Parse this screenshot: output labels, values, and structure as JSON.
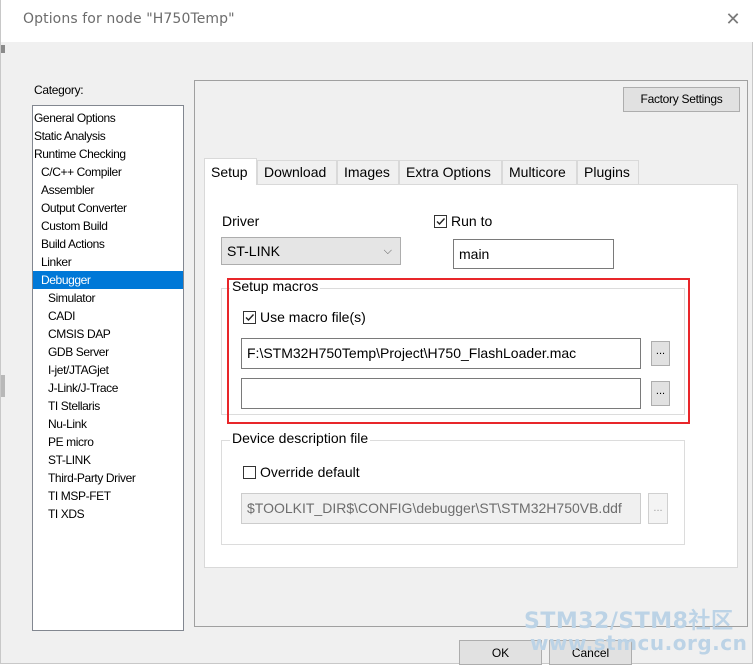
{
  "window": {
    "title": "Options for node \"H750Temp\""
  },
  "category": {
    "label": "Category:",
    "items": [
      {
        "label": "General Options",
        "level": 0,
        "selected": false
      },
      {
        "label": "Static Analysis",
        "level": 0,
        "selected": false
      },
      {
        "label": "Runtime Checking",
        "level": 0,
        "selected": false
      },
      {
        "label": "C/C++ Compiler",
        "level": 1,
        "selected": false
      },
      {
        "label": "Assembler",
        "level": 1,
        "selected": false
      },
      {
        "label": "Output Converter",
        "level": 1,
        "selected": false
      },
      {
        "label": "Custom Build",
        "level": 1,
        "selected": false
      },
      {
        "label": "Build Actions",
        "level": 1,
        "selected": false
      },
      {
        "label": "Linker",
        "level": 1,
        "selected": false
      },
      {
        "label": "Debugger",
        "level": 1,
        "selected": true
      },
      {
        "label": "Simulator",
        "level": 2,
        "selected": false
      },
      {
        "label": "CADI",
        "level": 2,
        "selected": false
      },
      {
        "label": "CMSIS DAP",
        "level": 2,
        "selected": false
      },
      {
        "label": "GDB Server",
        "level": 2,
        "selected": false
      },
      {
        "label": "I-jet/JTAGjet",
        "level": 2,
        "selected": false
      },
      {
        "label": "J-Link/J-Trace",
        "level": 2,
        "selected": false
      },
      {
        "label": "TI Stellaris",
        "level": 2,
        "selected": false
      },
      {
        "label": "Nu-Link",
        "level": 2,
        "selected": false
      },
      {
        "label": "PE micro",
        "level": 2,
        "selected": false
      },
      {
        "label": "ST-LINK",
        "level": 2,
        "selected": false
      },
      {
        "label": "Third-Party Driver",
        "level": 2,
        "selected": false
      },
      {
        "label": "TI MSP-FET",
        "level": 2,
        "selected": false
      },
      {
        "label": "TI XDS",
        "level": 2,
        "selected": false
      }
    ]
  },
  "factory_settings_label": "Factory Settings",
  "tabs": [
    {
      "label": "Setup",
      "active": true
    },
    {
      "label": "Download",
      "active": false
    },
    {
      "label": "Images",
      "active": false
    },
    {
      "label": "Extra Options",
      "active": false
    },
    {
      "label": "Multicore",
      "active": false
    },
    {
      "label": "Plugins",
      "active": false
    }
  ],
  "setup": {
    "driver_label": "Driver",
    "driver_value": "ST-LINK",
    "run_to_label": "Run to",
    "run_to_checked": true,
    "run_to_value": "main",
    "setup_macros": {
      "legend": "Setup macros",
      "use_macro_label": "Use macro file(s)",
      "use_macro_checked": true,
      "macro_file_1": "F:\\STM32H750Temp\\Project\\H750_FlashLoader.mac",
      "macro_file_2": "",
      "browse_label": "..."
    },
    "device_description": {
      "legend": "Device description file",
      "override_label": "Override default",
      "override_checked": false,
      "ddf_path": "$TOOLKIT_DIR$\\CONFIG\\debugger\\ST\\STM32H750VB.ddf",
      "browse_label": "..."
    }
  },
  "buttons": {
    "ok": "OK",
    "cancel": "Cancel"
  },
  "watermark": {
    "line1": "STM32/STM8社区",
    "line2": "www.stmcu.org.cn"
  },
  "colors": {
    "selection": "#0078d7",
    "highlight_box": "#e8262a",
    "watermark": "#bcd3e6"
  }
}
